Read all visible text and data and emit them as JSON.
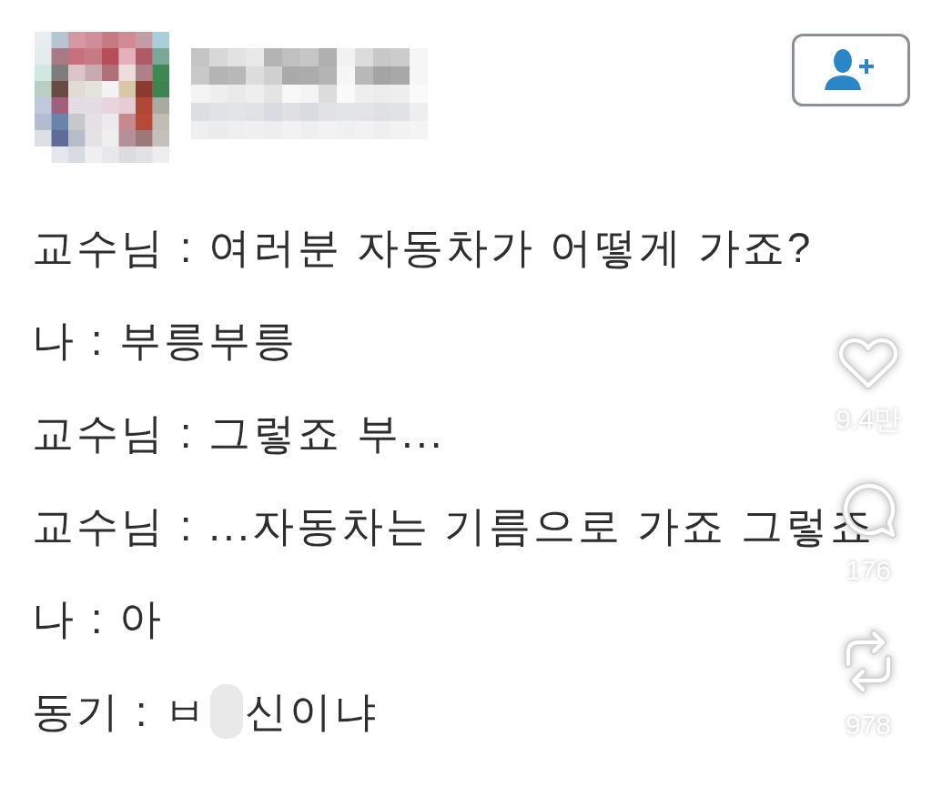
{
  "lines": [
    {
      "kind": "plain",
      "text": "교수님 : 여러분 자동차가 어떻게 가죠?"
    },
    {
      "kind": "plain",
      "text": "나 : 부릉부릉"
    },
    {
      "kind": "plain",
      "text": "교수님 : 그렇죠 부..."
    },
    {
      "kind": "plain",
      "text": "교수님 : ...자동차는 기름으로 가죠 그렇죠"
    },
    {
      "kind": "plain",
      "text": "나 : 아"
    },
    {
      "kind": "censored",
      "before": "동기 : ㅂ",
      "after": "신이냐"
    }
  ],
  "actions": [
    {
      "kind": "like",
      "count": "9.4만"
    },
    {
      "kind": "comment",
      "count": "176"
    },
    {
      "kind": "repost",
      "count": "978"
    }
  ]
}
